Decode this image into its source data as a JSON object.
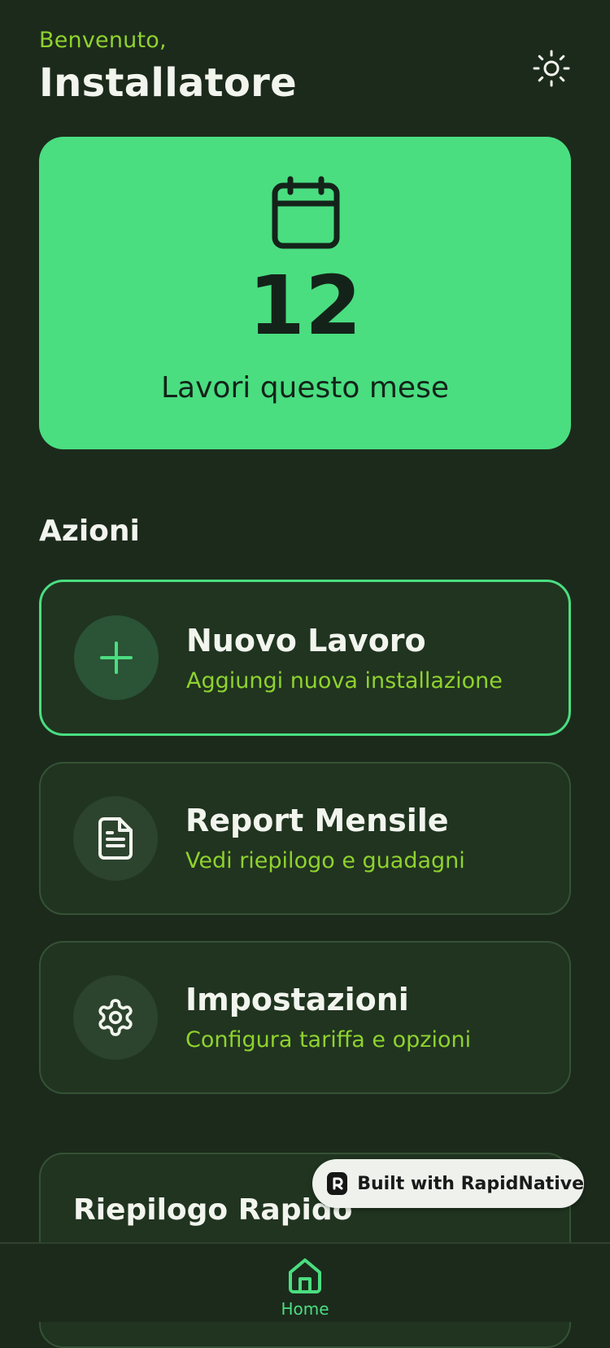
{
  "header": {
    "greeting": "Benvenuto,",
    "title": "Installatore",
    "theme_icon": "sun-icon"
  },
  "hero": {
    "icon": "calendar-icon",
    "count": "12",
    "label": "Lavori questo mese"
  },
  "actions": {
    "section_title": "Azioni",
    "items": [
      {
        "icon": "plus-icon",
        "title": "Nuovo Lavoro",
        "subtitle": "Aggiungi nuova installazione"
      },
      {
        "icon": "document-icon",
        "title": "Report Mensile",
        "subtitle": "Vedi riepilogo e guadagni"
      },
      {
        "icon": "gear-icon",
        "title": "Impostazioni",
        "subtitle": "Configura tariffa e opzioni"
      }
    ]
  },
  "summary": {
    "title": "Riepilogo Rapido"
  },
  "badge": {
    "label": "Built with RapidNative"
  },
  "nav": {
    "home_label": "Home",
    "home_icon": "home-icon"
  },
  "colors": {
    "background": "#1c2a1c",
    "accent": "#4ade80",
    "subtitle_green": "#8fd22e",
    "card": "#203420",
    "hero_text": "#14231a"
  }
}
